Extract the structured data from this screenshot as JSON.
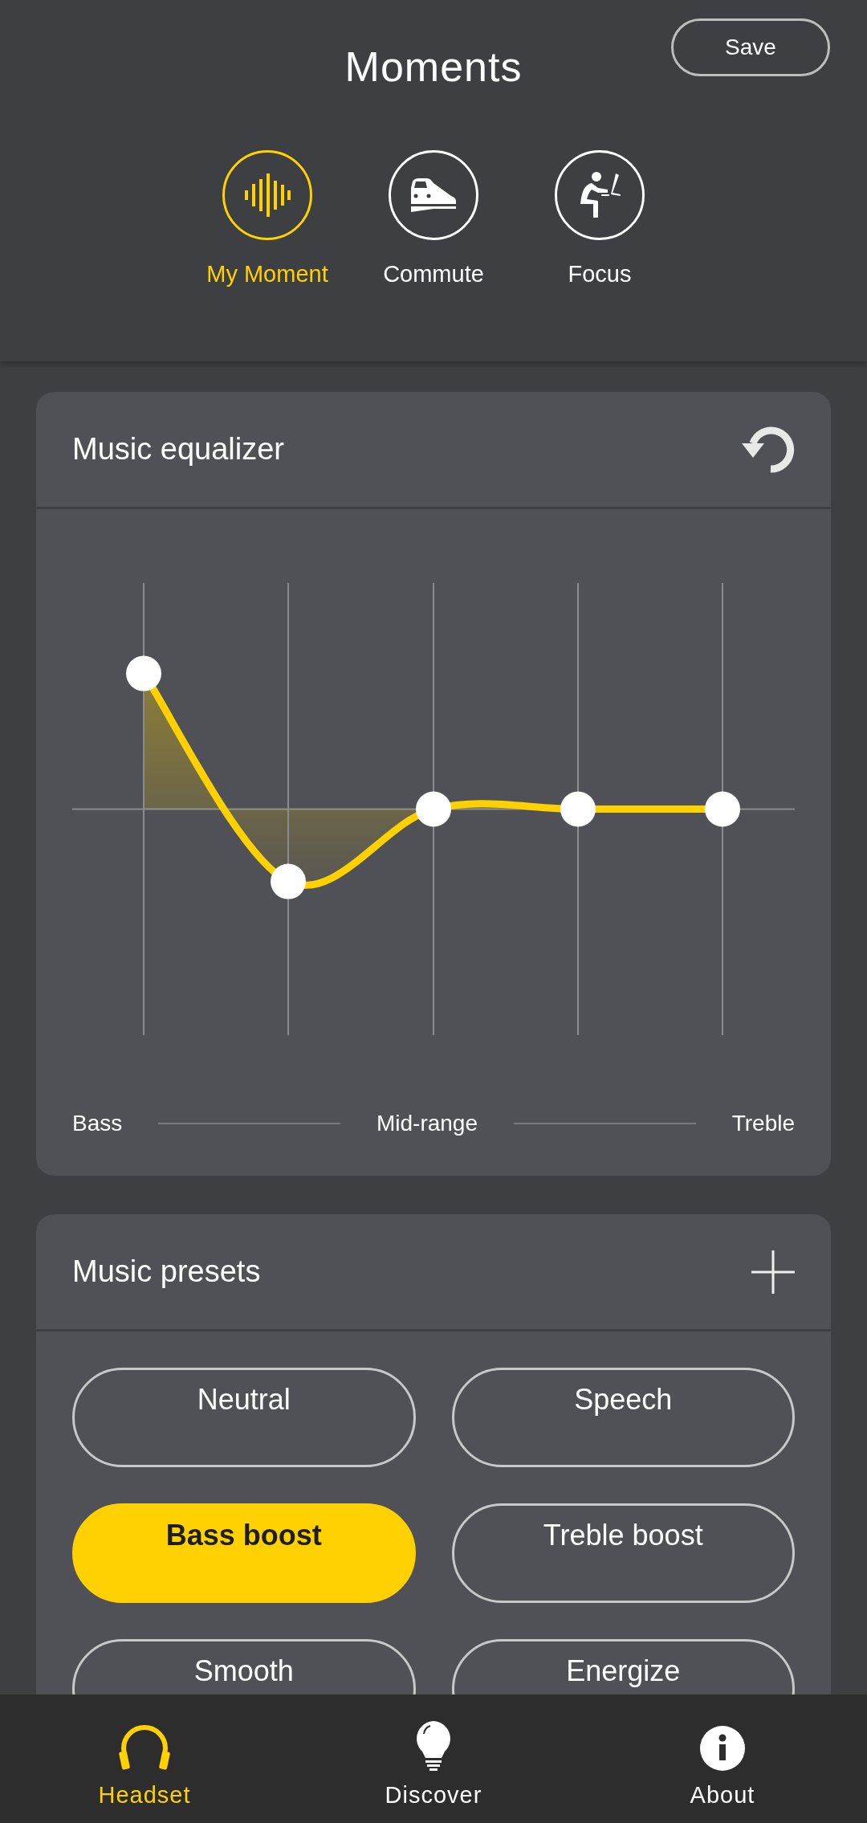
{
  "header": {
    "title": "Moments",
    "save_button": "Save"
  },
  "moments": [
    {
      "kind": "wave",
      "label": "My Moment",
      "selected": true
    },
    {
      "kind": "train",
      "label": "Commute",
      "selected": false
    },
    {
      "kind": "desk",
      "label": "Focus",
      "selected": false
    }
  ],
  "equalizer": {
    "title": "Music equalizer",
    "bands": [
      {
        "level": 0.8
      },
      {
        "level": 0.34
      },
      {
        "level": 0.5
      },
      {
        "level": 0.5
      },
      {
        "level": 0.5
      }
    ],
    "range_labels": [
      "Bass",
      "Mid-range",
      "Treble"
    ]
  },
  "presets": {
    "title": "Music presets",
    "items": [
      {
        "label": "Neutral",
        "selected": false
      },
      {
        "label": "Speech",
        "selected": false
      },
      {
        "label": "Bass boost",
        "selected": true
      },
      {
        "label": "Treble boost",
        "selected": false
      },
      {
        "label": "Smooth",
        "selected": false
      },
      {
        "label": "Energize",
        "selected": false
      }
    ]
  },
  "bottom_nav": [
    {
      "kind": "headset",
      "label": "Headset",
      "selected": true
    },
    {
      "kind": "bulb",
      "label": "Discover",
      "selected": false
    },
    {
      "kind": "info",
      "label": "About",
      "selected": false
    }
  ]
}
